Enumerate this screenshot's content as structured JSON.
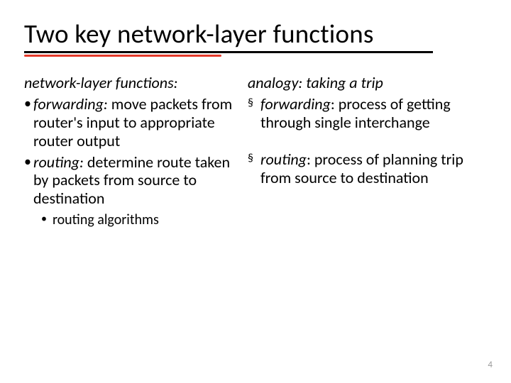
{
  "title": "Two key network-layer functions",
  "left": {
    "heading": "network-layer functions:",
    "b1_term": "forwarding:",
    "b1_rest": " move packets from router's input to appropriate router output",
    "b2_term": "routing:",
    "b2_rest": " determine route taken by packets from source to destination",
    "sub1": "routing algorithms"
  },
  "right": {
    "heading": "analogy: taking a trip",
    "b1_term": "forwarding",
    "b1_rest": ": process of getting through single interchange",
    "b2_term": "routing",
    "b2_rest": ": process of planning trip from source to destination"
  },
  "page": "4"
}
